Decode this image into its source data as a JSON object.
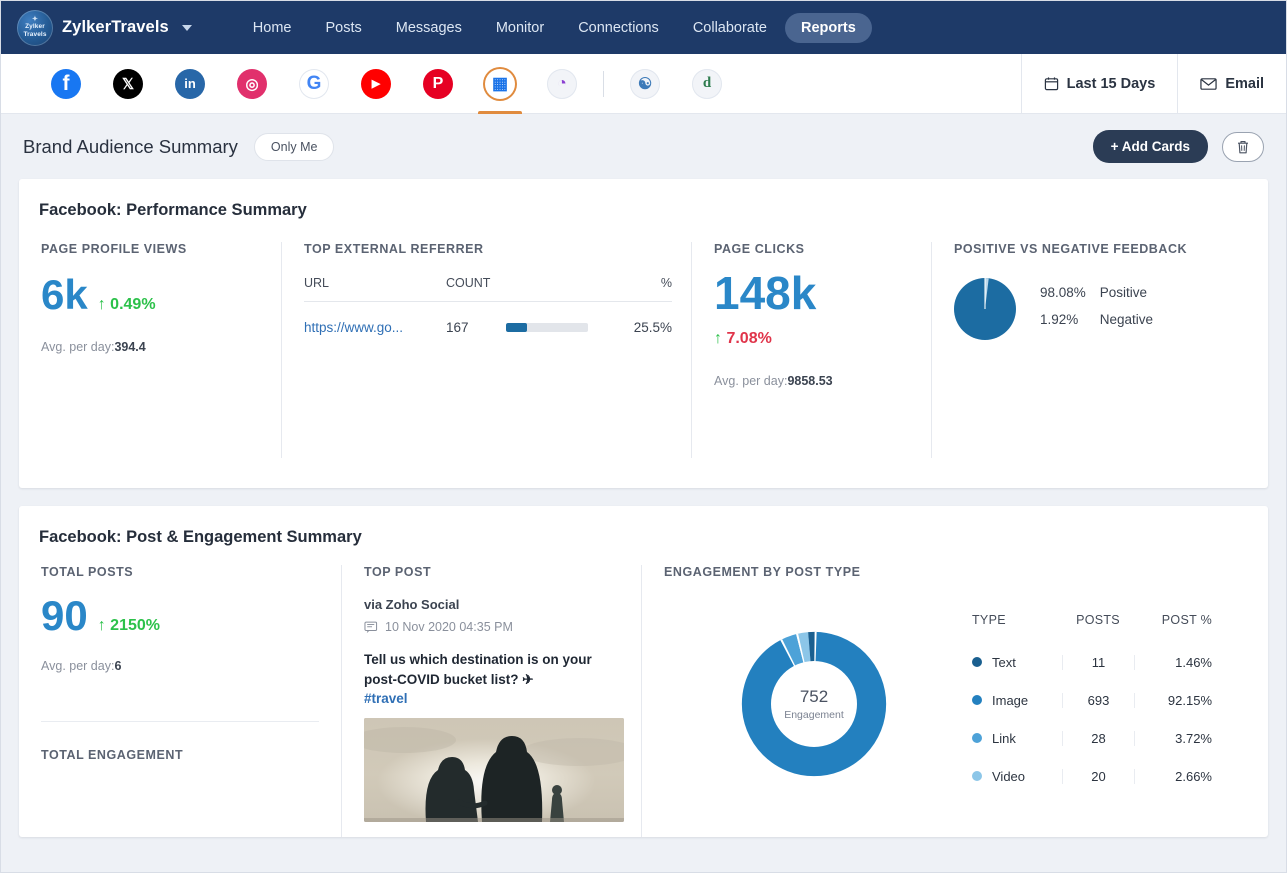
{
  "topnav": {
    "logo_line1": "Zylker",
    "logo_line2": "Travels",
    "brand": "ZylkerTravels",
    "chevron_icon": "chevron-down-icon",
    "links": [
      {
        "label": "Home",
        "active": false
      },
      {
        "label": "Posts",
        "active": false
      },
      {
        "label": "Messages",
        "active": false
      },
      {
        "label": "Monitor",
        "active": false
      },
      {
        "label": "Connections",
        "active": false
      },
      {
        "label": "Collaborate",
        "active": false
      },
      {
        "label": "Reports",
        "active": true
      }
    ]
  },
  "channelbar": {
    "channels": [
      {
        "name": "facebook",
        "glyph": "f",
        "color": "#1877f2",
        "active": false
      },
      {
        "name": "x-twitter",
        "glyph": "✕",
        "color": "#000000",
        "active": false
      },
      {
        "name": "linkedin",
        "glyph": "in",
        "color": "#2867a8",
        "active": false
      },
      {
        "name": "instagram",
        "glyph": "◎",
        "color": "#e1306c",
        "active": false
      },
      {
        "name": "google-business",
        "glyph": "G",
        "color": "#4285f4",
        "active": false
      },
      {
        "name": "youtube",
        "glyph": "▶",
        "color": "#ff0000",
        "active": false
      },
      {
        "name": "pinterest",
        "glyph": "P",
        "color": "#e60023",
        "active": false
      },
      {
        "name": "dashboard-grid",
        "glyph": "▦",
        "color": "#1a73e8",
        "active": true
      },
      {
        "name": "tiktok-analytics",
        "glyph": "◔",
        "color": "#8a3fd1",
        "active": false
      }
    ],
    "extra_channels": [
      {
        "name": "link-chain",
        "glyph": "∞",
        "color": "#3d7ab8"
      },
      {
        "name": "zoho-desk",
        "glyph": "⏚",
        "color": "#2f7d4f"
      }
    ],
    "date_range": "Last 15 Days",
    "date_icon": "calendar-icon",
    "email": "Email",
    "email_icon": "envelope-icon"
  },
  "pagehead": {
    "title": "Brand Audience Summary",
    "visibility": "Only Me",
    "add_cards": "+ Add Cards",
    "delete_icon": "trash-icon"
  },
  "card1": {
    "title": "Facebook: Performance Summary",
    "page_profile_views": {
      "label": "PAGE PROFILE VIEWS",
      "value": "6k",
      "delta": "0.49%",
      "delta_arrow": "↑",
      "delta_color": "#2cc14a",
      "avg_label": "Avg. per day:",
      "avg_value": "394.4"
    },
    "top_external_referrer": {
      "label": "TOP EXTERNAL REFERRER",
      "columns": [
        "URL",
        "COUNT",
        "%"
      ],
      "rows": [
        {
          "url": "https://www.go...",
          "count": "167",
          "pct": "25.5%",
          "bar_pct": 25.5
        }
      ]
    },
    "page_clicks": {
      "label": "PAGE CLICKS",
      "value": "148k",
      "delta": "7.08%",
      "delta_arrow": "↑",
      "delta_color": "#e0344a",
      "avg_label": "Avg. per day:",
      "avg_value": "9858.53"
    },
    "feedback": {
      "label": "POSITIVE VS NEGATIVE FEEDBACK",
      "positive_pct": "98.08%",
      "positive_label": "Positive",
      "negative_pct": "1.92%",
      "negative_label": "Negative"
    }
  },
  "card2": {
    "title": "Facebook: Post & Engagement Summary",
    "total_posts": {
      "label": "TOTAL POSTS",
      "value": "90",
      "delta": "2150%",
      "delta_arrow": "↑",
      "avg_label": "Avg. per day:",
      "avg_value": "6"
    },
    "total_engagement_label": "TOTAL ENGAGEMENT",
    "top_post": {
      "label": "TOP POST",
      "via": "via Zoho Social",
      "time_icon": "comment-icon",
      "time": "10 Nov 2020 04:35 PM",
      "text": "Tell us which destination is on your post-COVID bucket list? ✈",
      "hashtag": "#travel",
      "image_alt": "couple-silhouette-sunset-photo"
    },
    "engagement_by_post_type": {
      "label": "ENGAGEMENT BY POST TYPE",
      "center_value": "752",
      "center_caption": "Engagement",
      "columns": [
        "TYPE",
        "POSTS",
        "POST %"
      ],
      "rows": [
        {
          "type": "Text",
          "posts": "11",
          "pct": "1.46%",
          "color": "#1a5f8f"
        },
        {
          "type": "Image",
          "posts": "693",
          "pct": "92.15%",
          "color": "#2380bf"
        },
        {
          "type": "Link",
          "posts": "28",
          "pct": "3.72%",
          "color": "#4da2d8"
        },
        {
          "type": "Video",
          "posts": "20",
          "pct": "2.66%",
          "color": "#8cc6e8"
        }
      ]
    }
  },
  "chart_data": [
    {
      "type": "pie",
      "title": "POSITIVE VS NEGATIVE FEEDBACK",
      "categories": [
        "Positive",
        "Negative"
      ],
      "values": [
        98.08,
        1.92
      ],
      "colors": [
        "#1c6ca2",
        "#9ecbe6"
      ],
      "unit": "%",
      "legend": "right"
    },
    {
      "type": "pie",
      "title": "ENGAGEMENT BY POST TYPE",
      "subtype": "donut",
      "center_label": "752 Engagement",
      "categories": [
        "Text",
        "Image",
        "Link",
        "Video"
      ],
      "values": [
        1.46,
        92.15,
        3.72,
        2.66
      ],
      "counts": [
        11,
        693,
        28,
        20
      ],
      "colors": [
        "#1a5f8f",
        "#2380bf",
        "#4da2d8",
        "#8cc6e8"
      ],
      "unit": "%",
      "legend": "right-table"
    },
    {
      "type": "bar",
      "title": "TOP EXTERNAL REFERRER",
      "orientation": "horizontal",
      "categories": [
        "https://www.go..."
      ],
      "values": [
        25.5
      ],
      "counts": [
        167
      ],
      "xlabel": "%",
      "ylabel": "URL",
      "xlim": [
        0,
        100
      ],
      "grid": false,
      "colors": [
        "#1c6ca2"
      ]
    }
  ]
}
